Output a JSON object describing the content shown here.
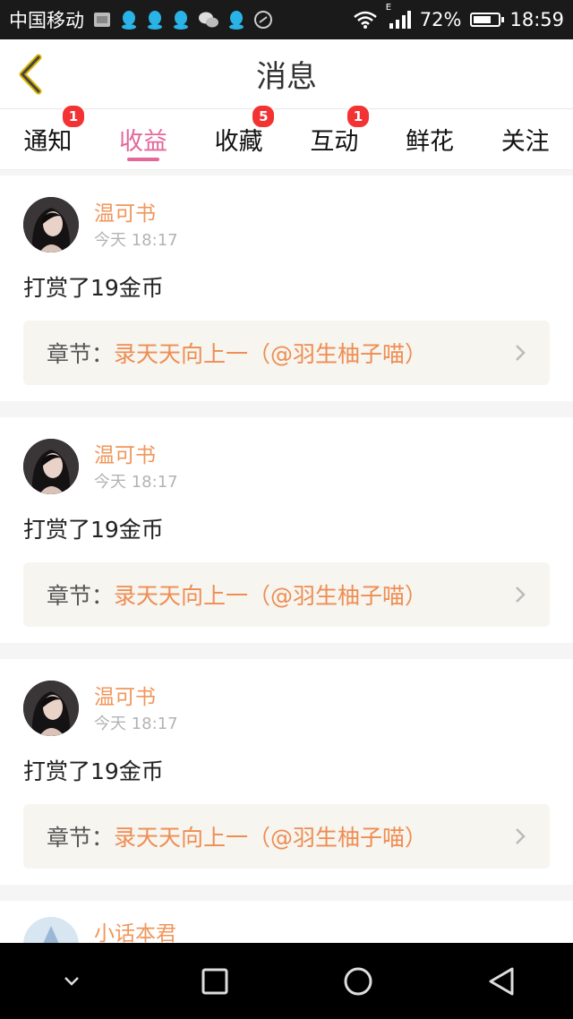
{
  "status_bar": {
    "carrier": "中国移动",
    "network_type": "E",
    "battery": "72%",
    "battery_level": 0.72,
    "time": "18:59",
    "icons": [
      "sim-icon",
      "qq-icon",
      "qq-icon",
      "qq-icon",
      "wechat-icon",
      "qq-icon",
      "vpn-icon"
    ]
  },
  "header": {
    "title": "消息",
    "back_icon": "chevron-left-icon"
  },
  "tabs": [
    {
      "label": "通知",
      "badge": "1"
    },
    {
      "label": "收益",
      "badge": "",
      "active": true
    },
    {
      "label": "收藏",
      "badge": "5"
    },
    {
      "label": "互动",
      "badge": "1"
    },
    {
      "label": "鲜花",
      "badge": ""
    },
    {
      "label": "关注",
      "badge": ""
    }
  ],
  "messages": [
    {
      "user": "温可书",
      "time": "今天 18:17",
      "text": "打赏了19金币",
      "chapter_label": "章节：",
      "chapter_title": "录天天向上一（@羽生柚子喵）"
    },
    {
      "user": "温可书",
      "time": "今天 18:17",
      "text": "打赏了19金币",
      "chapter_label": "章节：",
      "chapter_title": "录天天向上一（@羽生柚子喵）"
    },
    {
      "user": "温可书",
      "time": "今天 18:17",
      "text": "打赏了19金币",
      "chapter_label": "章节：",
      "chapter_title": "录天天向上一（@羽生柚子喵）"
    },
    {
      "user": "小话本君"
    }
  ],
  "colors": {
    "accent": "#e4679a",
    "username": "#f0965a",
    "badge": "#f33333"
  },
  "nav": {
    "icons": [
      "chevron-down-icon",
      "square-icon",
      "circle-icon",
      "triangle-back-icon"
    ]
  }
}
